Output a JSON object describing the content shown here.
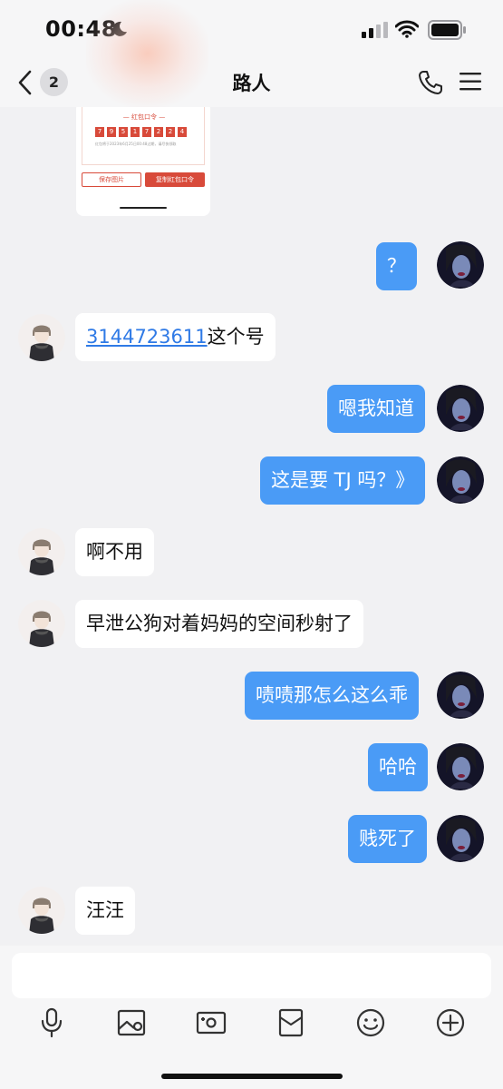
{
  "status_bar": {
    "time": "00:48",
    "icons": [
      "moon-icon",
      "signal-icon",
      "wifi-icon",
      "battery-icon"
    ]
  },
  "header": {
    "back_icon": "chevron-left-icon",
    "unread_count": "2",
    "title": "路人",
    "call_icon": "phone-icon",
    "menu_icon": "hamburger-menu-icon"
  },
  "redpacket_preview": {
    "title": "— 红包口令 —",
    "digits": [
      "7",
      "9",
      "5",
      "1",
      "7",
      "2",
      "2",
      "4"
    ],
    "note": "红包将于2023年6月25日00:48过期，请尽快领取",
    "save_label": "保存图片",
    "copy_label": "复制红包口令"
  },
  "messages": [
    {
      "sender": "me",
      "text": "？"
    },
    {
      "sender": "them",
      "link": "3144723611",
      "text": "这个号"
    },
    {
      "sender": "me",
      "text": "嗯我知道"
    },
    {
      "sender": "me",
      "text": "这是要 TJ 吗？》"
    },
    {
      "sender": "them",
      "text": "啊不用"
    },
    {
      "sender": "them",
      "text": "早泄公狗对着妈妈的空间秒射了"
    },
    {
      "sender": "me",
      "text": "啧啧那怎么这么乖"
    },
    {
      "sender": "me",
      "text": "哈哈"
    },
    {
      "sender": "me",
      "text": "贱死了"
    },
    {
      "sender": "them",
      "text": "汪汪"
    }
  ],
  "input": {
    "placeholder": ""
  },
  "toolbar": {
    "icons": [
      "microphone-icon",
      "image-icon",
      "camera-icon",
      "red-packet-icon",
      "emoji-icon",
      "plus-circle-icon"
    ]
  },
  "colors": {
    "my_bubble": "#4a9bf6",
    "their_bubble": "#ffffff",
    "chat_background": "#f1f1f3",
    "link": "#2f7ae6",
    "redpacket_red": "#d84a3a"
  }
}
